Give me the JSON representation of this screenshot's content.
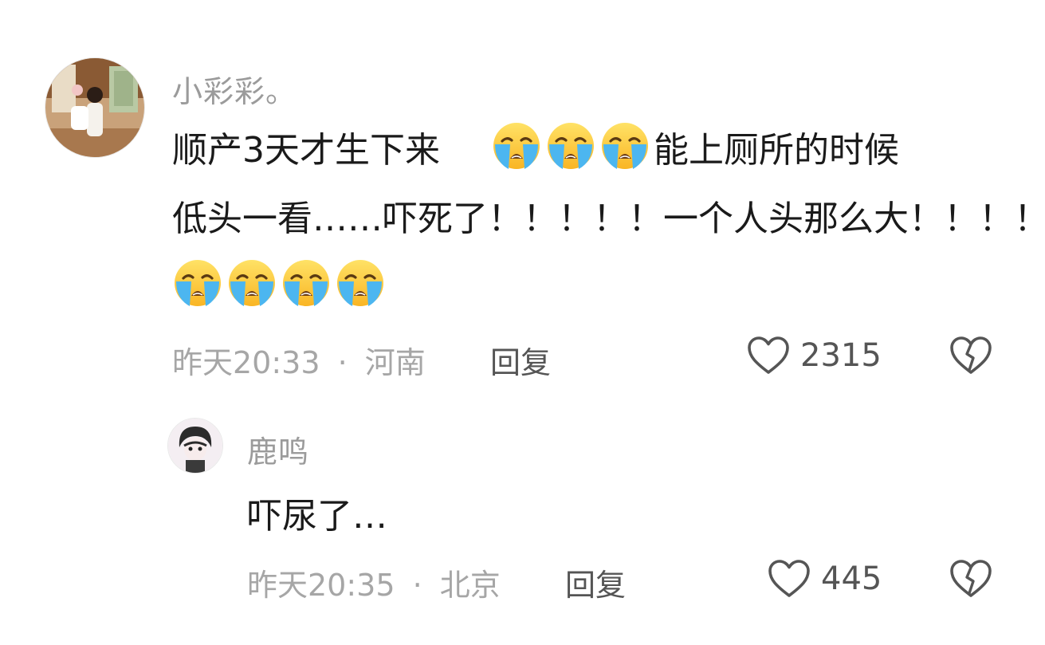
{
  "comments": [
    {
      "username": "小彩彩。",
      "lines": [
        {
          "t1": "顺产3天才生下来",
          "emoji_count": 3,
          "t2": "能上厕所的时候"
        },
        {
          "t1": "低头一看……吓死了！！！！！一个人头那么大！！！！"
        }
      ],
      "trailing_emoji_count": 4,
      "emoji": "loudly-crying-face",
      "time": "昨天20:33",
      "separator": "·",
      "location": "河南",
      "reply_label": "回复",
      "likes": "2315"
    },
    {
      "username": "鹿鸣",
      "text": "吓尿了…",
      "time": "昨天20:35",
      "separator": "·",
      "location": "北京",
      "reply_label": "回复",
      "likes": "445"
    }
  ],
  "colors": {
    "username": "#9b9b9b",
    "meta": "#a6a6a6",
    "action": "#555555",
    "text": "#1a1a1a"
  }
}
